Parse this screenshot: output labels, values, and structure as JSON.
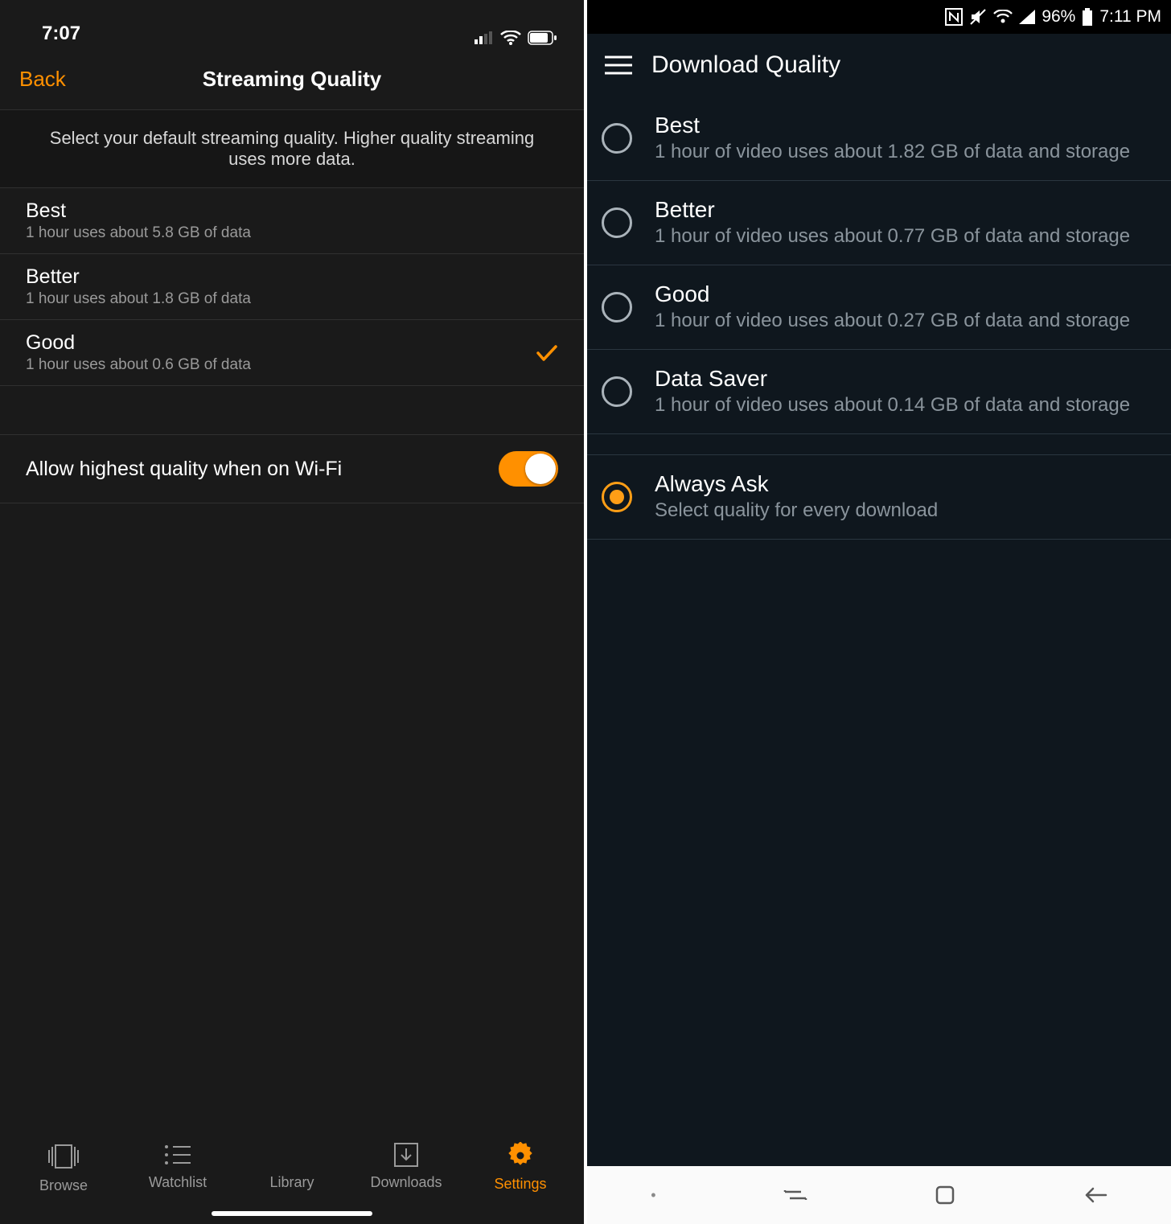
{
  "ios": {
    "status": {
      "time": "7:07"
    },
    "nav": {
      "back": "Back",
      "title": "Streaming Quality"
    },
    "helper": "Select your default streaming quality. Higher quality streaming uses more data.",
    "rows": [
      {
        "title": "Best",
        "sub": "1 hour uses about 5.8 GB of data",
        "selected": false
      },
      {
        "title": "Better",
        "sub": "1 hour uses about 1.8 GB of data",
        "selected": false
      },
      {
        "title": "Good",
        "sub": "1 hour uses about 0.6 GB of data",
        "selected": true
      }
    ],
    "toggle": {
      "label": "Allow highest quality when on Wi-Fi",
      "on": true
    },
    "tabs": [
      {
        "label": "Browse",
        "active": false
      },
      {
        "label": "Watchlist",
        "active": false
      },
      {
        "label": "Library",
        "active": false
      },
      {
        "label": "Downloads",
        "active": false
      },
      {
        "label": "Settings",
        "active": true
      }
    ]
  },
  "android": {
    "status": {
      "battery": "96%",
      "time": "7:11 PM"
    },
    "app_title": "Download Quality",
    "options": [
      {
        "title": "Best",
        "sub": "1 hour of video uses about 1.82 GB of data and storage",
        "selected": false
      },
      {
        "title": "Better",
        "sub": "1 hour of video uses about 0.77 GB of data and storage",
        "selected": false
      },
      {
        "title": "Good",
        "sub": "1 hour of video uses about 0.27 GB of data and storage",
        "selected": false
      },
      {
        "title": "Data Saver",
        "sub": "1 hour of video uses about 0.14 GB of data and storage",
        "selected": false
      },
      {
        "title": "Always Ask",
        "sub": "Select quality for every download",
        "selected": true
      }
    ]
  }
}
